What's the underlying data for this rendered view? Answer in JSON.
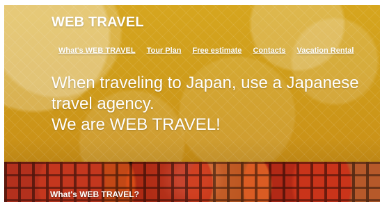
{
  "site": {
    "title": "WEB TRAVEL"
  },
  "nav": {
    "items": [
      {
        "label": "What's WEB TRAVEL"
      },
      {
        "label": "Tour Plan"
      },
      {
        "label": "Free estimate"
      },
      {
        "label": "Contacts"
      },
      {
        "label": "Vacation Rental"
      }
    ]
  },
  "hero": {
    "line1": "When traveling to Japan, use a Japanese",
    "line2": "travel agency.",
    "line3": "We are WEB TRAVEL!"
  },
  "section": {
    "title": "What's WEB TRAVEL?"
  },
  "colors": {
    "hero_base": "#cf9d1b",
    "text": "#ffffff",
    "photo_dark": "#1b0f0c"
  }
}
